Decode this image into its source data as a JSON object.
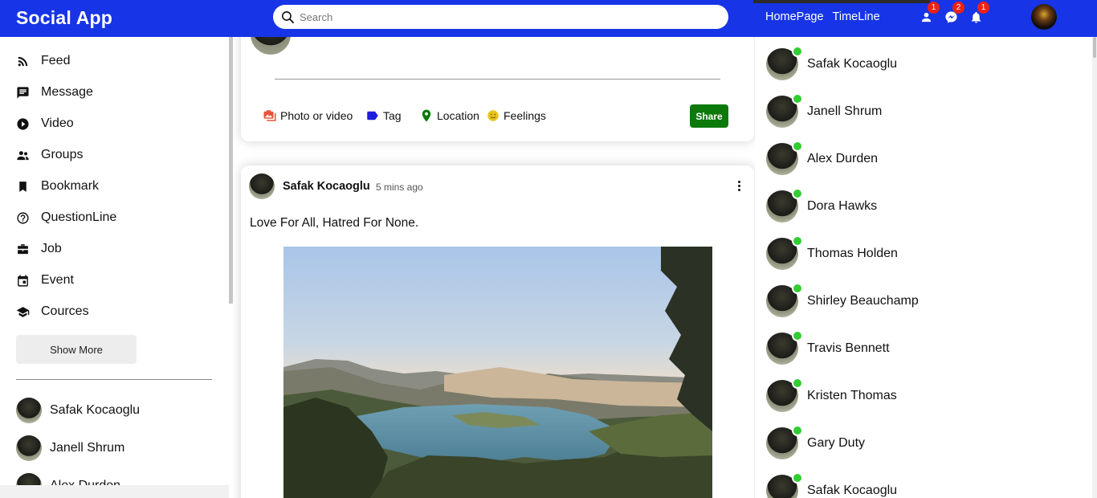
{
  "app": {
    "title": "Social App"
  },
  "search": {
    "placeholder": "Search"
  },
  "topbar": {
    "links": [
      "HomePage",
      "TimeLine"
    ],
    "badges": {
      "friends": "1",
      "messenger": "2",
      "notifications": "1"
    }
  },
  "sidebar": {
    "items": [
      {
        "label": "Feed",
        "icon": "rss-icon"
      },
      {
        "label": "Message",
        "icon": "chat-icon"
      },
      {
        "label": "Video",
        "icon": "play-circle-icon"
      },
      {
        "label": "Groups",
        "icon": "group-icon"
      },
      {
        "label": "Bookmark",
        "icon": "bookmark-icon"
      },
      {
        "label": "QuestionLine",
        "icon": "help-circle-icon"
      },
      {
        "label": "Job",
        "icon": "briefcase-icon"
      },
      {
        "label": "Event",
        "icon": "calendar-icon"
      },
      {
        "label": "Cources",
        "icon": "school-icon"
      }
    ],
    "show_more": "Show More",
    "friends": [
      "Safak Kocaoglu",
      "Janell Shrum",
      "Alex Durden"
    ]
  },
  "share": {
    "options": [
      {
        "label": "Photo or video",
        "icon": "photo-icon",
        "color": "#e8533c"
      },
      {
        "label": "Tag",
        "icon": "label-icon",
        "color": "#1d1ddb"
      },
      {
        "label": "Location",
        "icon": "location-pin-icon",
        "color": "#0b7a0b"
      },
      {
        "label": "Feelings",
        "icon": "emoji-icon",
        "color": "#e8c51b"
      }
    ],
    "button": "Share"
  },
  "post": {
    "author": "Safak Kocaoglu",
    "time": "5 mins ago",
    "text": "Love For All, Hatred For None."
  },
  "online": [
    "Safak Kocaoglu",
    "Janell Shrum",
    "Alex Durden",
    "Dora Hawks",
    "Thomas Holden",
    "Shirley Beauchamp",
    "Travis Bennett",
    "Kristen Thomas",
    "Gary Duty",
    "Safak Kocaoglu"
  ],
  "colors": {
    "topbar": "#1735e6",
    "online": "#32cd32",
    "share_button": "#0b7a0b",
    "badge": "#ee2211"
  }
}
